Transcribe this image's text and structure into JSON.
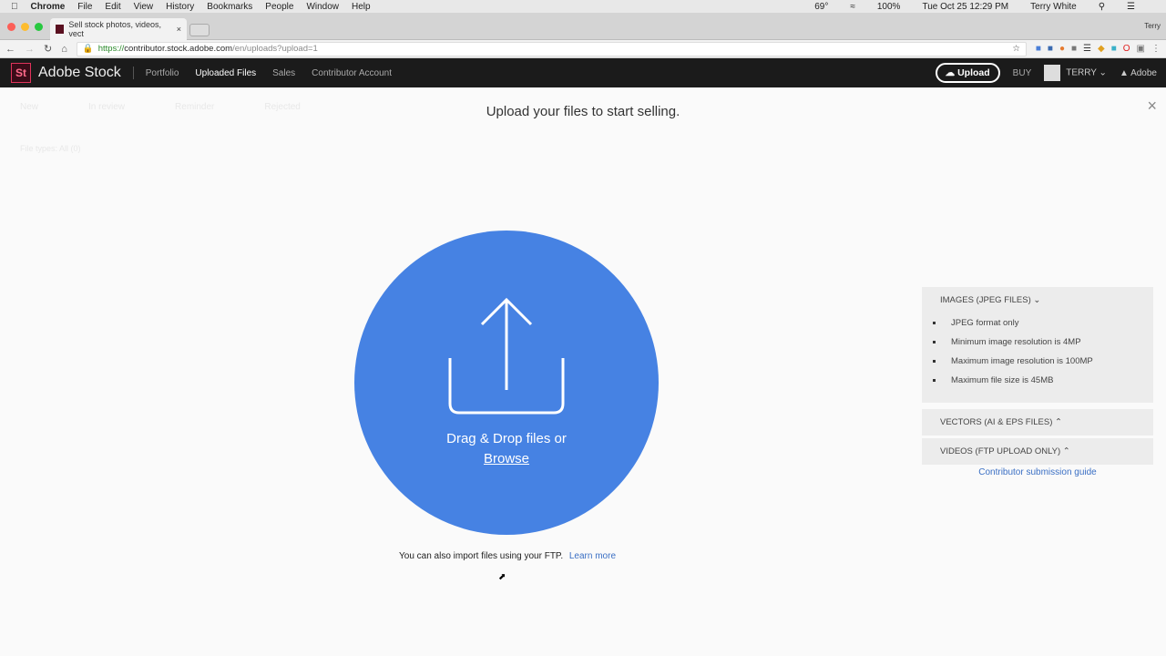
{
  "menubar": {
    "apple": "",
    "app": "Chrome",
    "items": [
      "File",
      "Edit",
      "View",
      "History",
      "Bookmarks",
      "People",
      "Window",
      "Help"
    ],
    "weather": "69°",
    "battery": "100%",
    "datetime": "Tue Oct 25 12:29 PM",
    "user": "Terry White"
  },
  "browser": {
    "tab_title": "Sell stock photos, videos, vect",
    "profile": "Terry",
    "url_scheme": "https://",
    "url_host": "contributor.stock.adobe.com",
    "url_path": "/en/uploads?upload=1"
  },
  "nav": {
    "logo": "St",
    "brand": "Adobe Stock",
    "links": [
      "Portfolio",
      "Uploaded Files",
      "Sales",
      "Contributor Account"
    ],
    "upload": "Upload",
    "buy": "BUY",
    "user": "TERRY",
    "adobe": "Adobe"
  },
  "background": {
    "tabs": [
      "New",
      "In review",
      "Reminder",
      "Rejected"
    ],
    "filter": "File types: All (0)"
  },
  "modal": {
    "title": "Upload your files to start selling.",
    "drop_text": "Drag & Drop files or",
    "browse": "Browse",
    "ftp_text": "You can also import files using your FTP.",
    "learn_more": "Learn more",
    "accent": "#4682e3"
  },
  "panel": {
    "images": {
      "header": "IMAGES (JPEG FILES)",
      "items": [
        "JPEG format only",
        "Minimum image resolution is 4MP",
        "Maximum image resolution is 100MP",
        "Maximum file size is 45MB"
      ]
    },
    "vectors": "VECTORS (AI & EPS FILES)",
    "videos": "VIDEOS (FTP UPLOAD ONLY)",
    "guide": "Contributor submission guide"
  }
}
